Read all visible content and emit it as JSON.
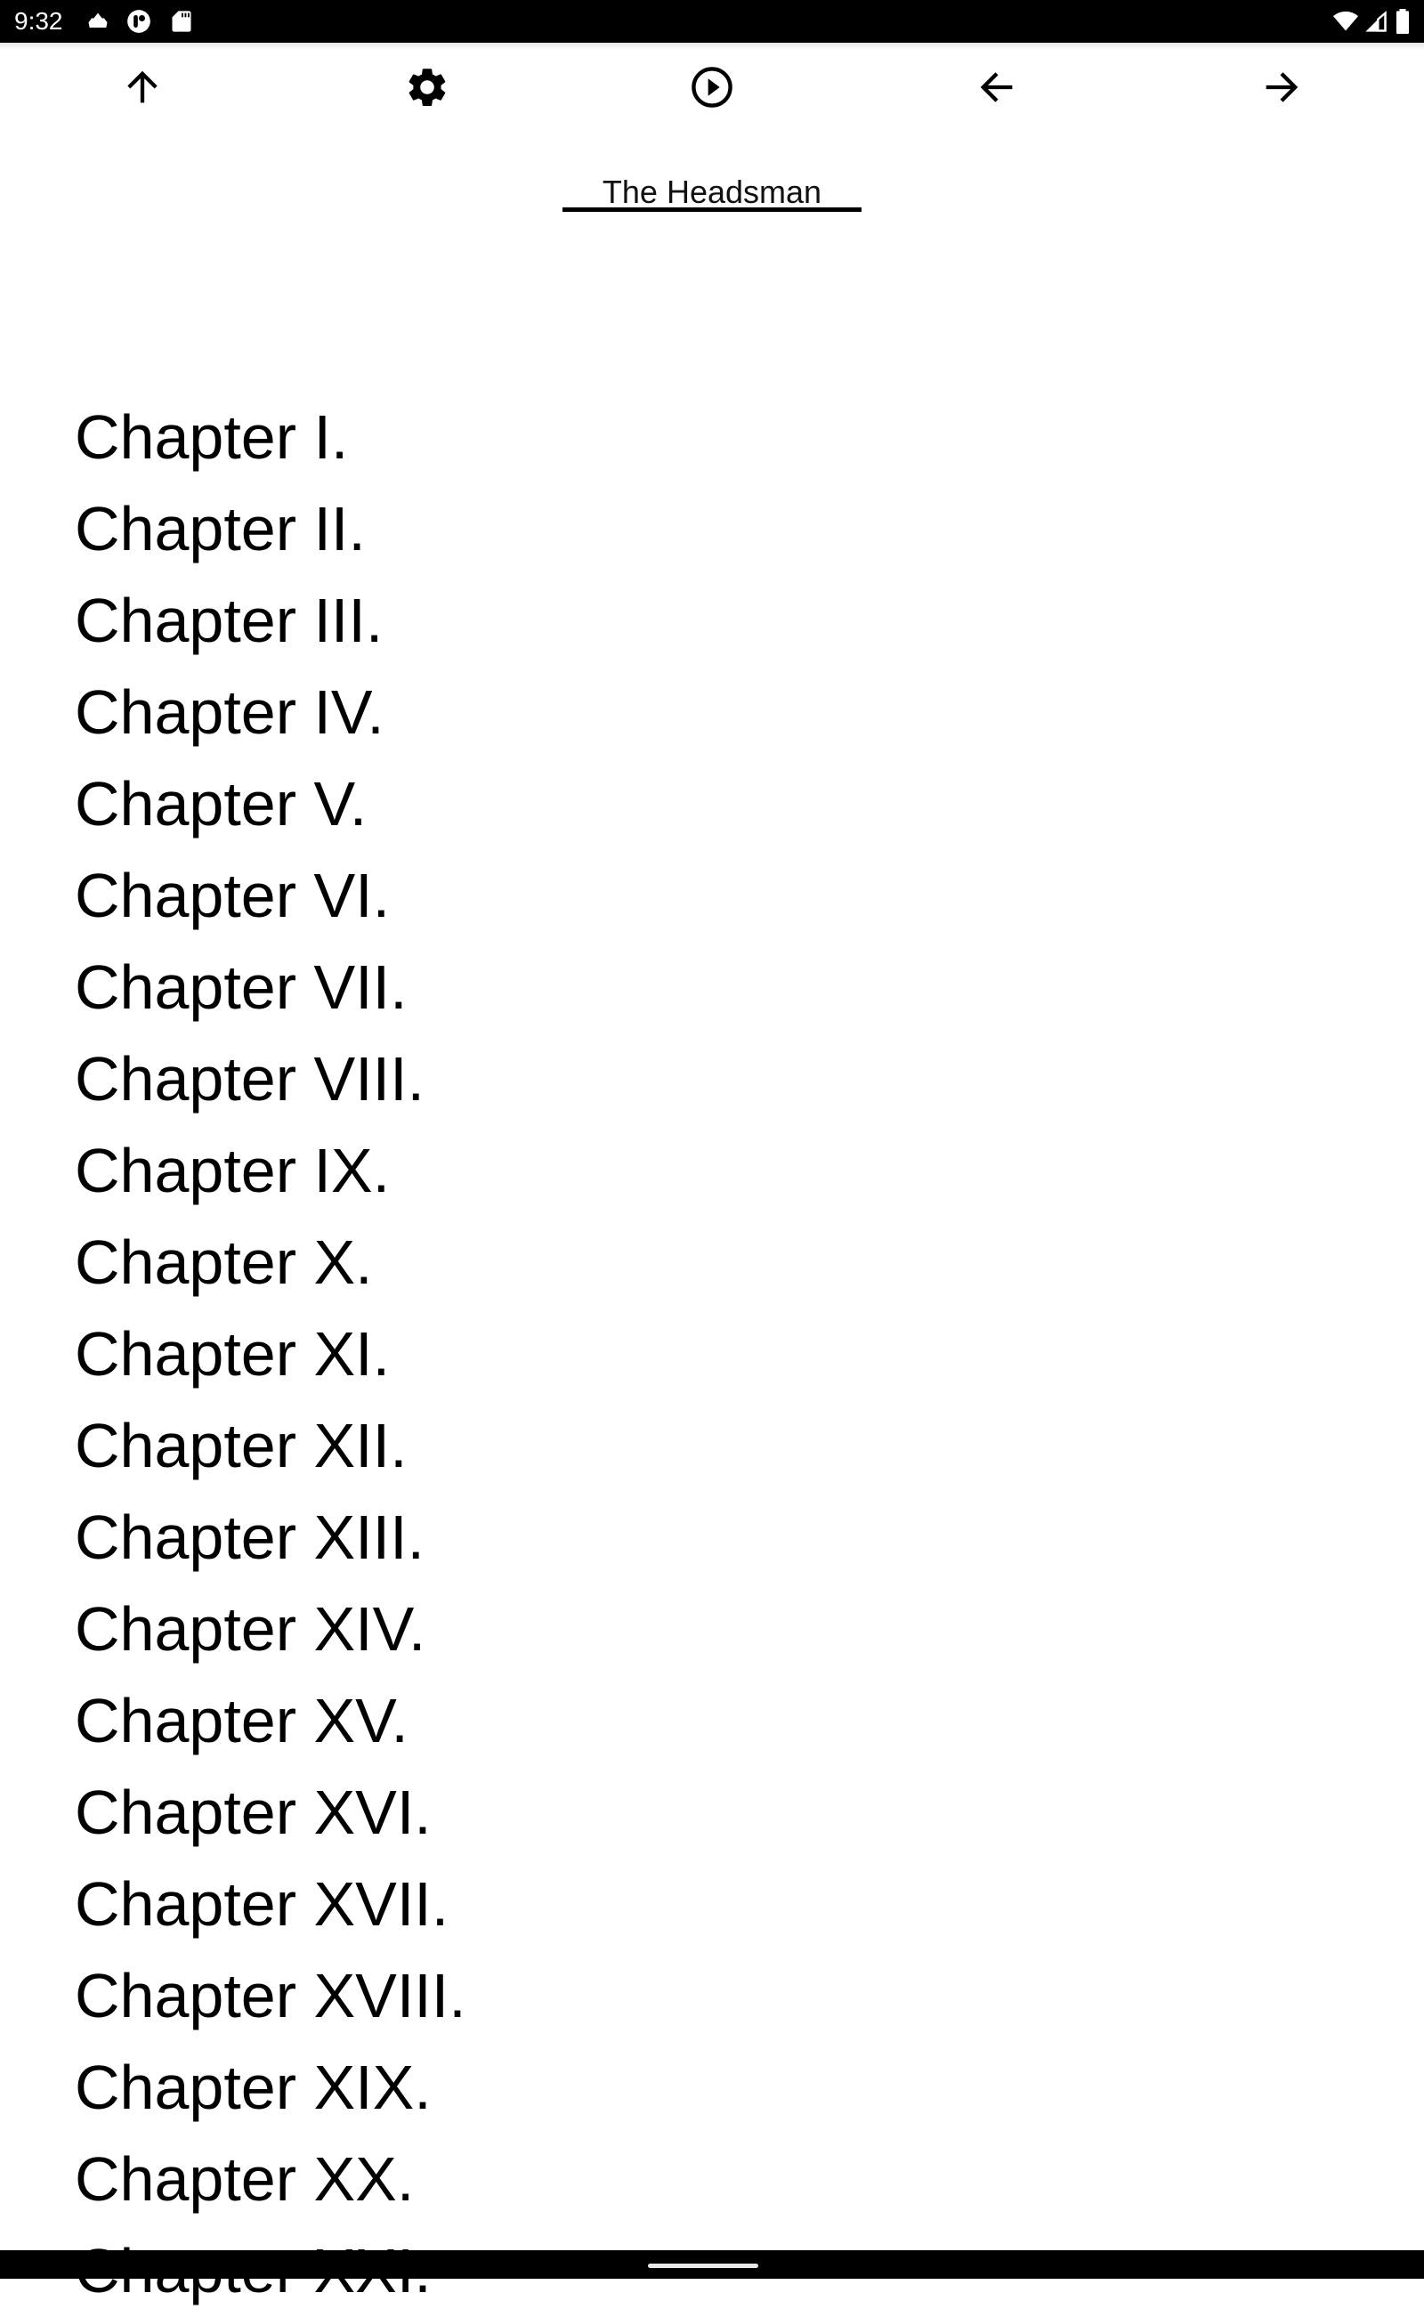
{
  "status_bar": {
    "time": "9:32",
    "left_icons": [
      "cloud-icon",
      "app-notification-icon",
      "sd-card-icon"
    ],
    "right_icons": [
      "wifi-icon",
      "cell-signal-icon",
      "battery-icon"
    ]
  },
  "toolbar": {
    "buttons": [
      {
        "icon": "arrow-up-icon",
        "label": "Up"
      },
      {
        "icon": "gear-icon",
        "label": "Settings"
      },
      {
        "icon": "play-circle-icon",
        "label": "Play"
      },
      {
        "icon": "arrow-left-icon",
        "label": "Back"
      },
      {
        "icon": "arrow-right-icon",
        "label": "Forward"
      }
    ]
  },
  "book": {
    "title": "The Headsman"
  },
  "chapters": [
    "Chapter I.",
    "Chapter II.",
    "Chapter III.",
    "Chapter IV.",
    "Chapter V.",
    "Chapter VI.",
    "Chapter VII.",
    "Chapter VIII.",
    "Chapter IX.",
    "Chapter X.",
    "Chapter XI.",
    "Chapter XII.",
    "Chapter XIII.",
    "Chapter XIV.",
    "Chapter XV.",
    "Chapter XVI.",
    "Chapter XVII.",
    "Chapter XVIII.",
    "Chapter XIX.",
    "Chapter XX.",
    "Chapter XXI."
  ]
}
